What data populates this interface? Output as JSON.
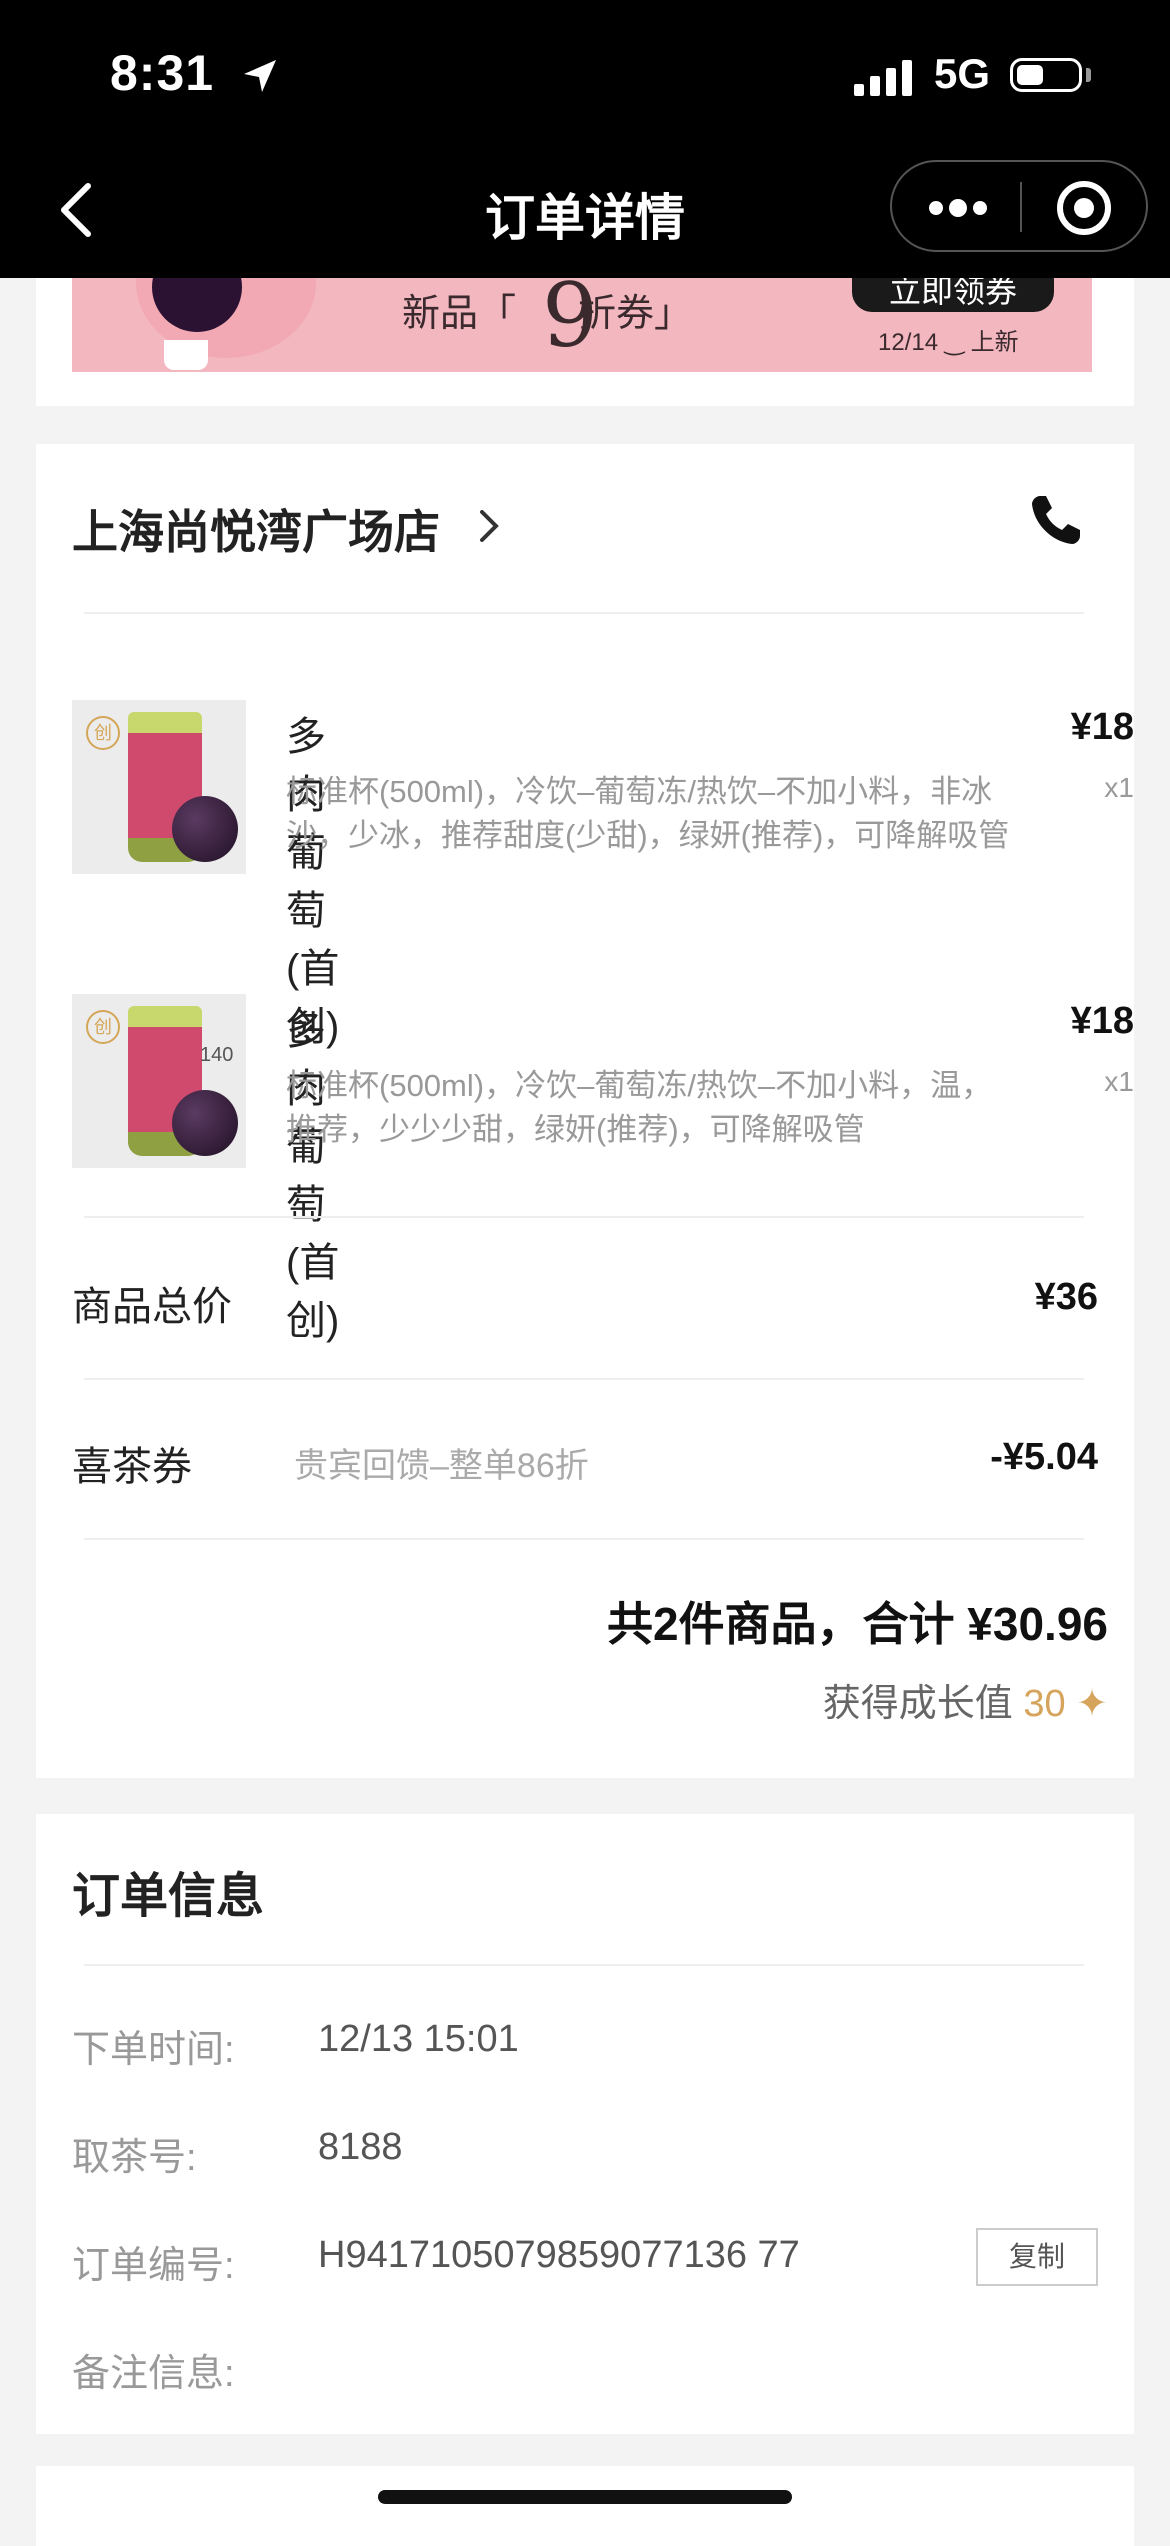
{
  "status_bar": {
    "time": "8:31",
    "network": "5G"
  },
  "nav": {
    "title": "订单详情"
  },
  "banner": {
    "text_left": "新品「",
    "text_nine": "9",
    "text_right": "折券」",
    "cta": "立即领券",
    "date": "12/14 ‿ 上新"
  },
  "store": {
    "name": "上海尚悦湾广场店"
  },
  "items": [
    {
      "name": "多肉葡萄(首创)",
      "spec": "标准杯(500ml)，冷饮–葡萄冻/热饮–不加小料，非冰沙，少冰，推荐甜度(少甜)，绿妍(推荐)，可降解吸管",
      "price": "¥18",
      "qty": "x1",
      "badge": "创"
    },
    {
      "name": "多肉葡萄(首创)",
      "spec": "标准杯(500ml)，冷饮–葡萄冻/热饮–不加小料，温，推荐，少少少甜，绿妍(推荐)，可降解吸管",
      "price": "¥18",
      "qty": "x1",
      "badge": "创",
      "kcal": "140"
    }
  ],
  "summary": {
    "subtotal_label": "商品总价",
    "subtotal_value": "¥36",
    "coupon_label": "喜茶券",
    "coupon_desc": "贵宾回馈–整单86折",
    "coupon_value": "-¥5.04",
    "total_text": "共2件商品，合计 ¥30.96",
    "growth_label": "获得成长值",
    "growth_value": "30",
    "growth_icon": "✦"
  },
  "order_info": {
    "title": "订单信息",
    "order_time_label": "下单时间:",
    "order_time_value": "12/13 15:01",
    "pickup_label": "取茶号:",
    "pickup_value": "8188",
    "order_no_label": "订单编号:",
    "order_no_value": "H9417105079859077136 77",
    "copy_label": "复制",
    "note_label": "备注信息:"
  }
}
